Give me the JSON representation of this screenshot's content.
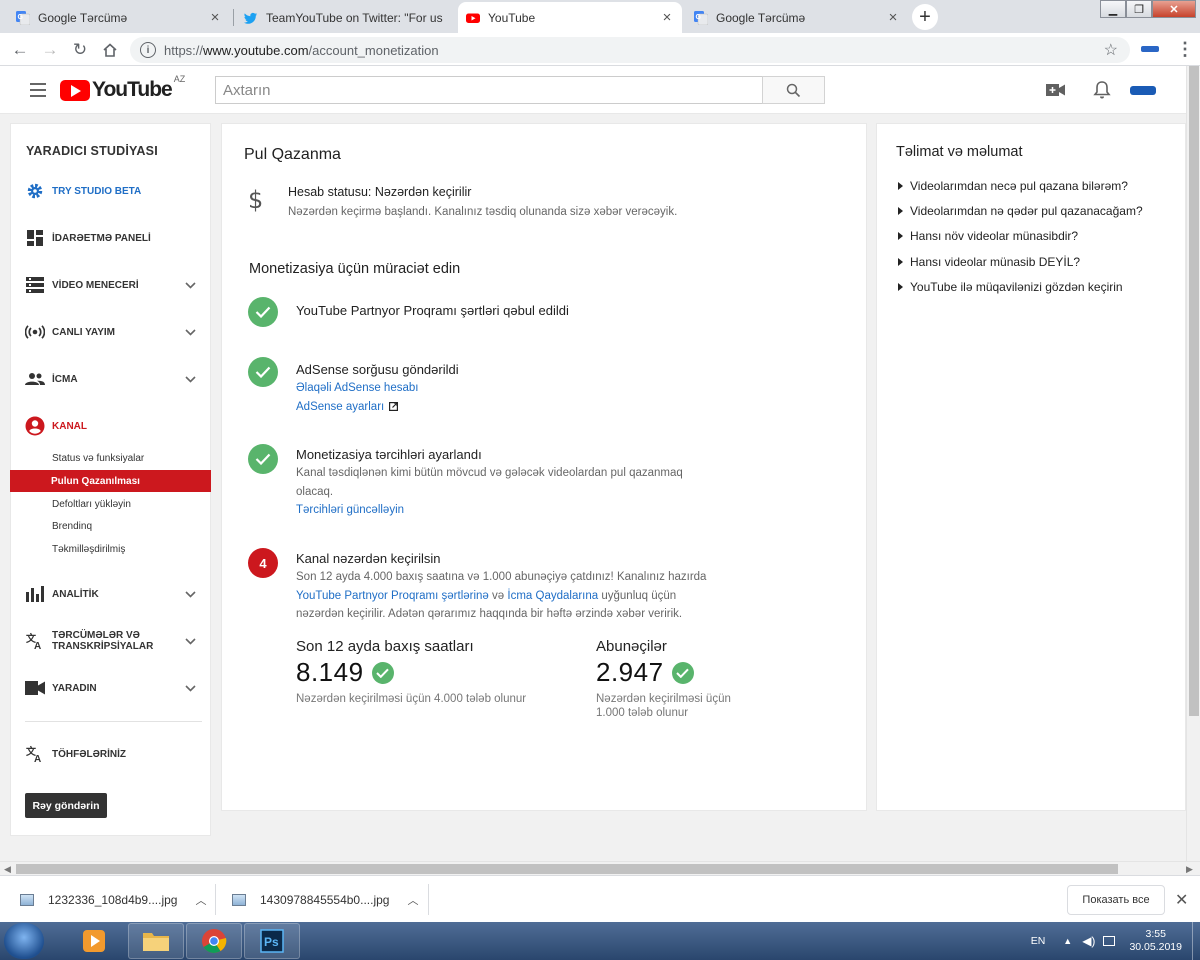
{
  "browser": {
    "tabs": [
      {
        "title": "Google Tərcümə",
        "icon": "google-translate-icon"
      },
      {
        "title": "TeamYouTube on Twitter: \"For us",
        "icon": "twitter-icon"
      },
      {
        "title": "YouTube",
        "icon": "youtube-icon"
      },
      {
        "title": "Google Tərcümə",
        "icon": "google-translate-icon"
      }
    ],
    "url_prefix": "https://",
    "url_host": "www.youtube.com",
    "url_path": "/account_monetization"
  },
  "header": {
    "logo_text": "YouTube",
    "region": "AZ",
    "search_placeholder": "Axtarın"
  },
  "sidebar": {
    "title": "YARADICI STUDİYASI",
    "items": [
      {
        "label": "TRY STUDIO BETA",
        "icon": "gear-icon",
        "style": "blue"
      },
      {
        "label": "İDARƏETMƏ PANELİ",
        "icon": "dashboard-icon"
      },
      {
        "label": "VİDEO MENECERİ",
        "icon": "video-manager-icon",
        "expandable": true
      },
      {
        "label": "CANLI YAYIM",
        "icon": "live-icon",
        "expandable": true
      },
      {
        "label": "İCMA",
        "icon": "community-icon",
        "expandable": true
      },
      {
        "label": "KANAL",
        "icon": "account-circle-icon",
        "style": "red"
      }
    ],
    "channel_sub": [
      "Status və funksiyalar",
      "Pulun Qazanılması",
      "Defoltları yükləyin",
      "Brendinq",
      "Təkmilləşdirilmiş"
    ],
    "items2": [
      {
        "label": "ANALİTİK",
        "icon": "analytics-icon",
        "expandable": true
      },
      {
        "label": "TƏRCÜMƏLƏR VƏ TRANSKRİPSİYALAR",
        "icon": "translate-icon",
        "expandable": true
      },
      {
        "label": "YARADIN",
        "icon": "create-icon",
        "expandable": true
      }
    ],
    "contributions": "TÖHFƏLƏRİNİZ",
    "feedback_button": "Rəy göndərin"
  },
  "main": {
    "title": "Pul Qazanma",
    "account_status": "Hesab statusu: Nəzərdən keçirilir",
    "account_desc": "Nəzərdən keçirmə başlandı. Kanalınız təsdiq olunanda sizə xəbər verəcəyik.",
    "apply_title": "Monetizasiya üçün müraciət edin",
    "step1": {
      "title": "YouTube Partnyor Proqramı şərtləri qəbul edildi"
    },
    "step2": {
      "title": "AdSense sorğusu göndərildi",
      "link1": "Əlaqəli AdSense hesabı",
      "link2": "AdSense ayarları"
    },
    "step3": {
      "title": "Monetizasiya tərcihləri ayarlandı",
      "text": "Kanal təsdiqlənən kimi bütün mövcud və gələcək videolardan pul qazanmaq olacaq.",
      "link": "Tərcihləri güncəlləyin"
    },
    "step4": {
      "number": "4",
      "title": "Kanal nəzərdən keçirilsin",
      "text_a": "Son 12 ayda 4.000 baxış saatına və 1.000 abunəçiyə çatdınız! Kanalınız hazırda",
      "link_a": "YouTube Partnyor Proqramı şərtlərinə",
      "text_b": "və",
      "link_b": "İcma Qaydalarına",
      "text_c": "uyğunluq üçün nəzərdən keçirilir. Adətən qərarımız haqqında bir həftə ərzində xəbər veririk."
    },
    "metrics": [
      {
        "label": "Son 12 ayda baxış saatları",
        "value": "8.149",
        "requirement": "Nəzərdən keçirilməsi üçün 4.000 tələb olunur"
      },
      {
        "label": "Abunəçilər",
        "value": "2.947",
        "requirement": "Nəzərdən keçirilməsi üçün 1.000 tələb olunur"
      }
    ]
  },
  "help": {
    "title": "Təlimat və məlumat",
    "items": [
      "Videolarımdan necə pul qazana bilərəm?",
      "Videolarımdan nə qədər pul qazanacağam?",
      "Hansı növ videolar münasibdir?",
      "Hansı videolar münasib DEYİL?",
      "YouTube ilə müqavilənizi gözdən keçirin"
    ]
  },
  "downloads": {
    "files": [
      "1232336_108d4b9....jpg",
      "1430978845554b0....jpg"
    ],
    "show_all": "Показать все"
  },
  "taskbar": {
    "lang": "EN",
    "time": "3:55",
    "date": "30.05.2019"
  },
  "colors": {
    "youtube_red": "#ff0000",
    "studio_red": "#cc181e",
    "link_blue": "#1f6ec6",
    "check_green": "#59b46c"
  }
}
